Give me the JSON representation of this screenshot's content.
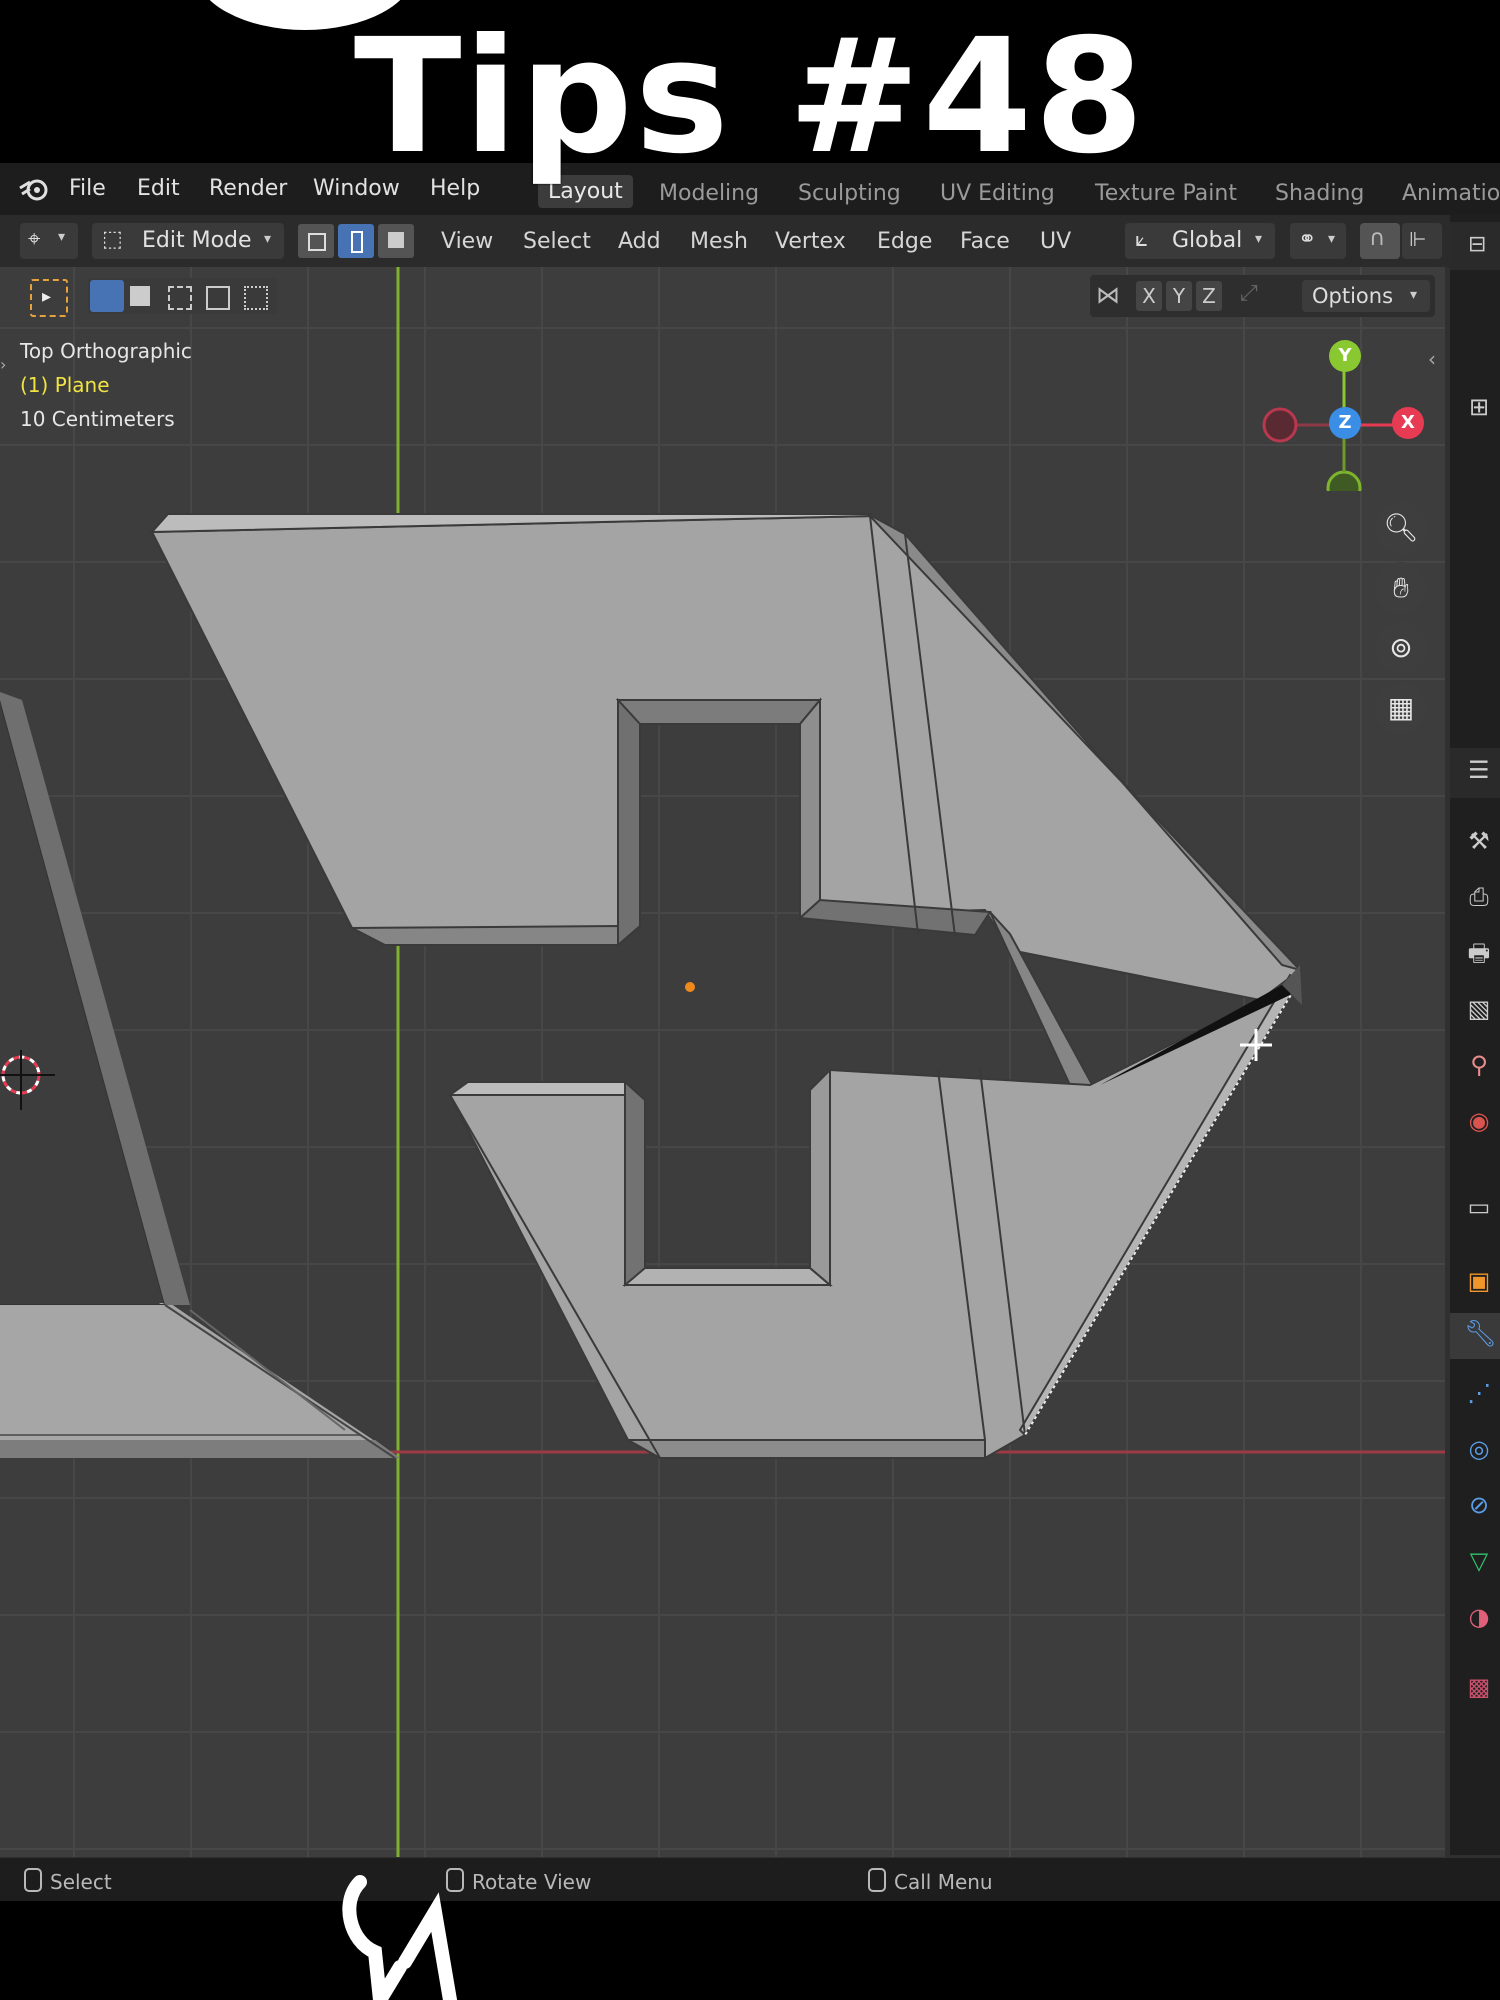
{
  "overlay": {
    "title": "Tips #48"
  },
  "menubar": {
    "items": [
      "File",
      "Edit",
      "Render",
      "Window",
      "Help"
    ],
    "workspaces": [
      "Layout",
      "Modeling",
      "Sculpting",
      "UV Editing",
      "Texture Paint",
      "Shading",
      "Animation"
    ]
  },
  "header": {
    "mode": "Edit Mode",
    "menus": [
      "View",
      "Select",
      "Add",
      "Mesh",
      "Vertex",
      "Edge",
      "Face",
      "UV"
    ],
    "orientation": "Global",
    "axes": [
      "X",
      "Y",
      "Z"
    ],
    "options": "Options",
    "select_mode_active": "edge"
  },
  "viewport": {
    "view_name": "Top Orthographic",
    "object_name": "(1) Plane",
    "grid_scale": "10 Centimeters",
    "gizmo": {
      "y": "Y",
      "z": "Z",
      "x": "X"
    }
  },
  "status": {
    "select": "Select",
    "rotate": "Rotate View",
    "menu": "Call Menu"
  },
  "colors": {
    "accent": "#4772b3",
    "x_axis": "#e63b52",
    "y_axis": "#8ac832",
    "z_axis": "#3b8ee6",
    "object_name": "#f0e442"
  }
}
